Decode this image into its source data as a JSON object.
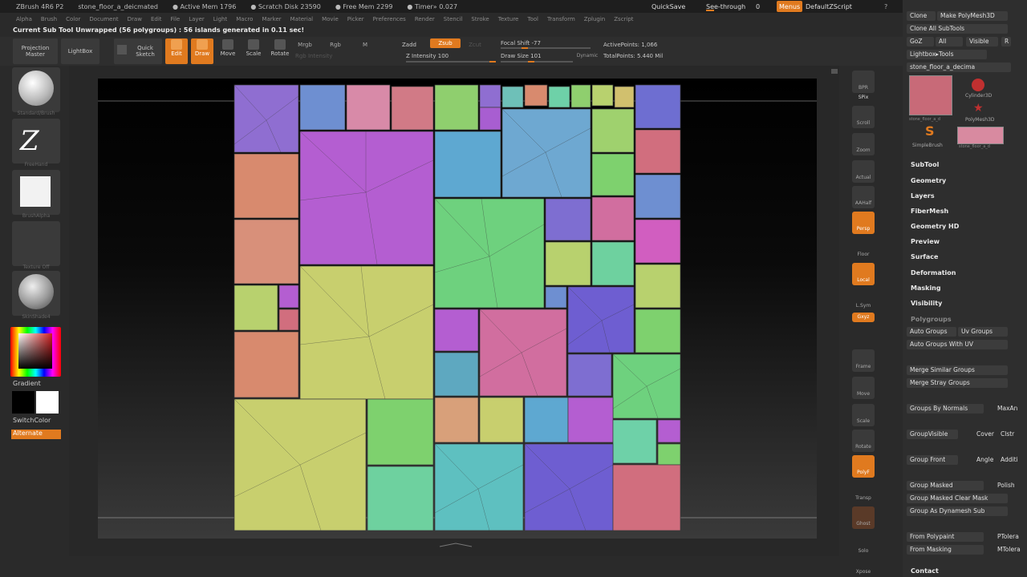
{
  "titlebar": {
    "items": [
      "ZBrush 4R6 P2",
      "stone_floor_a_deicmated",
      "● Active Mem 1796",
      "● Scratch Disk 23590",
      "● Free Mem 2299",
      "● Timer» 0.027"
    ],
    "quicksave": "QuickSave",
    "seethrough": "See-through",
    "seethrough_value": "0",
    "menus": "Menus",
    "defaultzscript": "DefaultZScript"
  },
  "menubar": [
    "Alpha",
    "Brush",
    "Color",
    "Document",
    "Draw",
    "Edit",
    "File",
    "Layer",
    "Light",
    "Macro",
    "Marker",
    "Material",
    "Movie",
    "Picker",
    "Preferences",
    "Render",
    "Stencil",
    "Stroke",
    "Texture",
    "Tool",
    "Transform",
    "Zplugin",
    "Zscript"
  ],
  "status": "Current Sub Tool Unwrapped (56 polygroups) : 56 islands generated in 0.11 sec!",
  "toolbar": {
    "projection_master": [
      "Projection",
      "Master"
    ],
    "lightbox": "LightBox",
    "quick_sketch": [
      "Quick",
      "Sketch"
    ],
    "edit": "Edit",
    "draw": "Draw",
    "move": "Move",
    "scale": "Scale",
    "rotate": "Rotate",
    "mrgb": "Mrgb",
    "rgb": "Rgb",
    "m": "M",
    "rgb_intensity": "Rgb Intensity",
    "zadd": "Zadd",
    "zsub": "Zsub",
    "zcut": "Zcut",
    "z_intensity_label": "Z Intensity",
    "z_intensity": "100",
    "focal_shift_label": "Focal Shift",
    "focal_shift": "-77",
    "draw_size_label": "Draw Size",
    "draw_size": "101",
    "dynamic": "Dynamic",
    "active_points_label": "ActivePoints:",
    "active_points": "1,066",
    "total_points_label": "TotalPoints:",
    "total_points": "5.440 Mil"
  },
  "leftshelf": {
    "captions": [
      "Standard/Brush",
      "FreeHand",
      "BrushAlpha",
      "Texture Off",
      "SkinShade4"
    ],
    "gradient": "Gradient",
    "switchcolor": "SwitchColor",
    "alternate": "Alternate"
  },
  "rightshelf": [
    "BPR",
    "SPix",
    "Scroll",
    "Zoom",
    "Actual",
    "AAHalf",
    "Persp",
    "Floor",
    "Local",
    "L.Sym",
    "Gxyz",
    "Frame",
    "Move",
    "Scale",
    "Rotate",
    "PolyF",
    "Transp",
    "Ghost",
    "Solo",
    "Xpose"
  ],
  "palette": {
    "top_buttons": [
      "Clone",
      "Make PolyMesh3D",
      "Clone All SubTools",
      "GoZ",
      "All",
      "Visible",
      "R",
      "Lightbox▸Tools"
    ],
    "tool_name": "stone_floor_a_decima",
    "tool_thumbs": [
      "stone_floor_a_d",
      "Cylinder3D",
      "PolyMesh3D",
      "SimpleBrush",
      "stone_floor_a_d"
    ],
    "sections": [
      "SubTool",
      "Geometry",
      "Layers",
      "FiberMesh",
      "Geometry HD",
      "Preview",
      "Surface",
      "Deformation",
      "Masking",
      "Visibility",
      "Polygroups"
    ],
    "polygroups": [
      [
        "Auto Groups",
        "Uv Groups"
      ],
      [
        "Auto Groups With UV"
      ],
      [
        "Merge Similar Groups"
      ],
      [
        "Merge Stray Groups"
      ],
      [
        "Groups By Normals",
        "MaxAn"
      ],
      [
        "GroupVisible",
        "Cover",
        "Clstr"
      ],
      [
        "Group Front",
        "Angle",
        "Additi"
      ],
      [
        "Group Masked",
        "Polish"
      ],
      [
        "Group Masked Clear Mask"
      ],
      [
        "Group As Dynamesh Sub"
      ],
      [
        "From Polypaint",
        "PTolera"
      ],
      [
        "From Masking",
        "MTolera"
      ]
    ],
    "contact": "Contact"
  },
  "colors": {
    "accent": "#e07a1f",
    "panel": "#2e2e2e",
    "button": "#3c3c3c"
  }
}
